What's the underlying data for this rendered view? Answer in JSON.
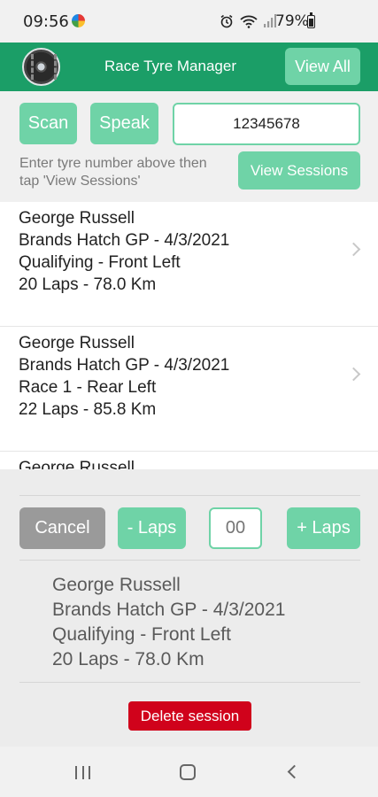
{
  "status_bar": {
    "time": "09:56",
    "battery": "79%",
    "icons": [
      "notification-icon",
      "alarm-icon",
      "wifi-icon",
      "signal-icon",
      "battery-icon"
    ]
  },
  "header": {
    "title": "Race Tyre Manager",
    "view_all_label": "View All",
    "accent_color": "#1b9e67",
    "button_color": "#6fd3a7"
  },
  "search": {
    "scan_label": "Scan",
    "speak_label": "Speak",
    "tyre_number": "12345678",
    "hint": "Enter tyre number above then tap 'View Sessions'",
    "view_sessions_label": "View Sessions"
  },
  "sessions": [
    {
      "driver": "George Russell",
      "circuit_date": "Brands Hatch GP  -  4/3/2021",
      "session_position": "Qualifying  -  Front Left",
      "laps_distance": "20  Laps  -  78.0 Km"
    },
    {
      "driver": "George Russell",
      "circuit_date": "Brands Hatch GP  -  4/3/2021",
      "session_position": "Race 1  -  Rear Left",
      "laps_distance": "22  Laps  -  85.8 Km"
    },
    {
      "driver": "George Russell",
      "circuit_date": "",
      "session_position": "",
      "laps_distance": ""
    }
  ],
  "panel": {
    "cancel_label": "Cancel",
    "minus_laps_label": "- Laps",
    "laps_placeholder": "00",
    "plus_laps_label": "+ Laps",
    "selected": {
      "driver": "George Russell",
      "circuit_date": "Brands Hatch GP  -  4/3/2021",
      "session_position": "Qualifying  -  Front Left",
      "laps_distance": "20  Laps  -  78.0 Km"
    },
    "delete_label": "Delete session",
    "delete_color": "#d0021b"
  }
}
